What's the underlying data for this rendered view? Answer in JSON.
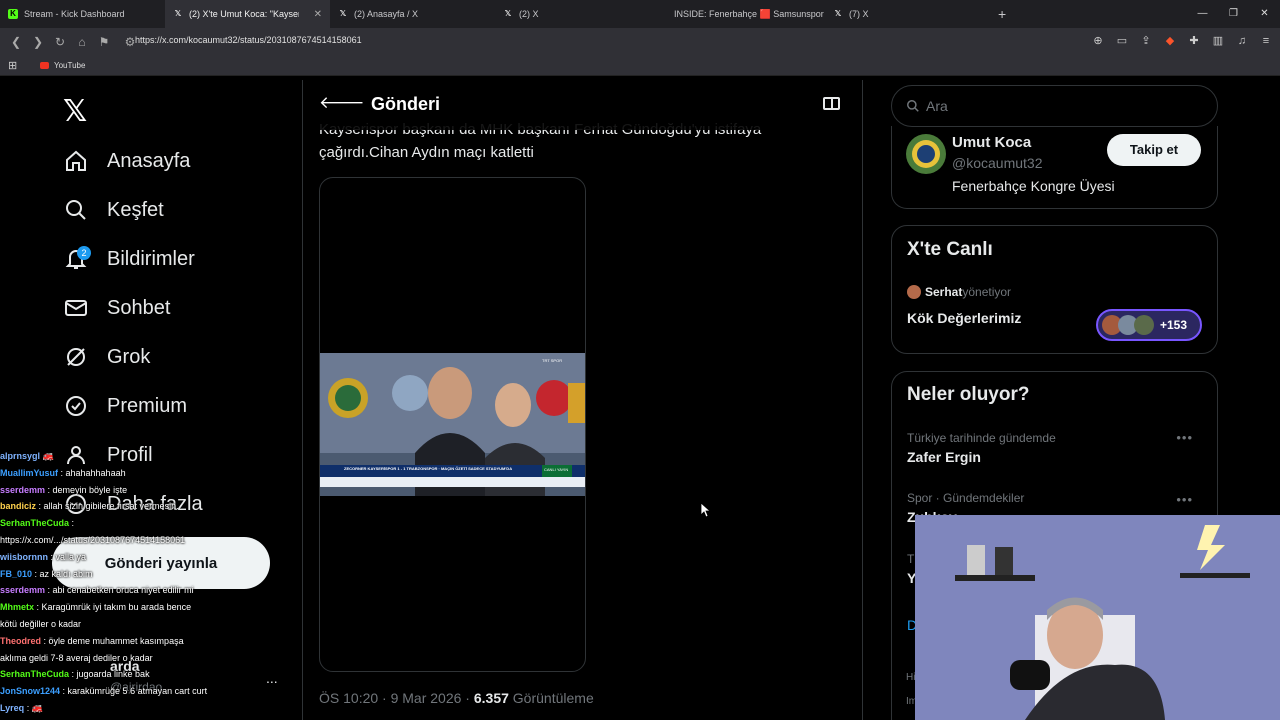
{
  "browser": {
    "tabs": [
      {
        "label": "Stream - Kick Dashboard",
        "icon": "kick-icon"
      },
      {
        "label": "(2) X'te Umut Koca: \"Kayseris",
        "icon": "x-icon",
        "active": true
      },
      {
        "label": "(2) Anasayfa / X",
        "icon": "x-icon"
      },
      {
        "label": "(2) X",
        "icon": "x-icon"
      },
      {
        "label": "INSIDE: Fenerbahçe 🟥 Samsunspor",
        "icon": "youtube-icon"
      },
      {
        "label": "(7) X",
        "icon": "x-icon"
      }
    ],
    "new_tab": "+",
    "url": "https://x.com/kocaumut32/status/2031087674514158061",
    "bookmark": "YouTube"
  },
  "nav": {
    "items": [
      {
        "label": "Anasayfa",
        "icon": "home-icon"
      },
      {
        "label": "Keşfet",
        "icon": "search-icon"
      },
      {
        "label": "Bildirimler",
        "icon": "bell-icon",
        "badge": "2"
      },
      {
        "label": "Sohbet",
        "icon": "mail-icon"
      },
      {
        "label": "Grok",
        "icon": "grok-icon"
      },
      {
        "label": "Premium",
        "icon": "verified-icon"
      },
      {
        "label": "Profil",
        "icon": "user-icon"
      },
      {
        "label": "Daha fazla",
        "icon": "more-icon"
      }
    ],
    "post_button": "Gönderi yayınla",
    "account_name": "arda",
    "account_handle": "@ajrirdao",
    "more": "..."
  },
  "post": {
    "header": "Gönderi",
    "text_line1": "Kayserispor başkanı da MHK başkanı Ferhat Gündoğdu'yu istifaya",
    "text_line2": "çağırdı.Cihan Aydın maçı katletti",
    "time": "ÖS 10:20 · 9 Mar 2026 · ",
    "views_count": "6.357",
    "views_label": " Görüntüleme",
    "ticker": "ZECORNER KAYSERİSPOR 1 - 1 TRABZONSPOR · MAÇIN ÖZETİ SADECE STADYUM'DA",
    "live": "CANLI YAYIN",
    "channel": "TRT SPOR"
  },
  "right": {
    "search_placeholder": "Ara",
    "profile": {
      "name": "Umut Koca",
      "handle": "@kocaumut32",
      "bio": "Fenerbahçe Kongre Üyesi",
      "follow": "Takip et"
    },
    "live": {
      "title": "X'te Canlı",
      "host": "Serhat",
      "host_suffix": " yönetiyor",
      "space": "Kök Değerlerimiz",
      "count": "+153"
    },
    "trends": {
      "title": "Neler oluyor?",
      "items": [
        {
          "context": "Türkiye tarihinde gündemde",
          "name": "Zafer Ergin"
        },
        {
          "context": "Spor · Gündemdekiler",
          "name": "Zubkov"
        },
        {
          "context": "Tü",
          "name": "Y"
        }
      ],
      "show_more": "D",
      "footer1": "Hi",
      "footer2": "Im"
    }
  },
  "chat": [
    {
      "user": "alprnsygl",
      "text": " 🚒",
      "c": "u1"
    },
    {
      "user": "MuallimYusuf",
      "text": " : ahahahhahaah",
      "c": "u5"
    },
    {
      "user": "sserdemm",
      "text": " : demeyin böyle işte",
      "c": "u2"
    },
    {
      "user": "bandiciz",
      "text": " : allah sizin gibilere fırsat vermesin.",
      "c": "u3"
    },
    {
      "user": "SerhanTheCuda",
      "text": " :",
      "c": "u4"
    },
    {
      "user": "",
      "text": "https://x.com/.../status/2031087674514158061",
      "c": "msg"
    },
    {
      "user": "wiisbornnn",
      "text": " : valla ya",
      "c": "u1"
    },
    {
      "user": "FB_010",
      "text": " : az kaldı abim",
      "c": "u5"
    },
    {
      "user": "sserdemm",
      "text": " : abi cenabetken oruca niyet edilir mi",
      "c": "u2"
    },
    {
      "user": "Mhmetx",
      "text": " : Karagümrük iyi takım bu arada bence",
      "c": "u4"
    },
    {
      "user": "",
      "text": "kötü değiller o kadar",
      "c": "msg"
    },
    {
      "user": "Theodred",
      "text": " : öyle deme muhammet kasımpaşa",
      "c": "u6"
    },
    {
      "user": "",
      "text": "aklıma geldi 7-8 averaj dediler o kadar",
      "c": "msg"
    },
    {
      "user": "SerhanTheCuda",
      "text": " : jugoarda linke bak",
      "c": "u4"
    },
    {
      "user": "JonSnow1244",
      "text": " : karakümrüğe 5 6 atmayan cart curt",
      "c": "u5"
    },
    {
      "user": "Lyreq",
      "text": " : 🚒",
      "c": "u1"
    }
  ]
}
